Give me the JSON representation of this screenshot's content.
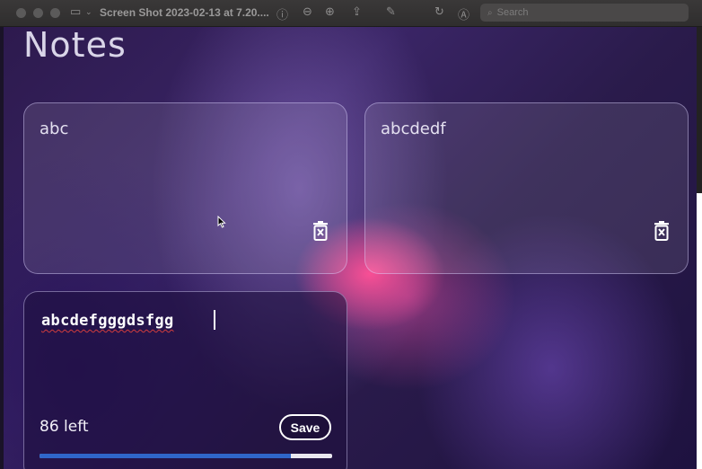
{
  "window": {
    "title": "Screen Shot 2023-02-13 at 7.20....",
    "search_placeholder": "Search"
  },
  "app": {
    "title": "Notes",
    "notes": [
      {
        "text": "abc"
      },
      {
        "text": "abcdedf"
      }
    ],
    "editor": {
      "value": "abcdefgggdsfgg",
      "chars_left_label": "86 left",
      "save_label": "Save",
      "progress_fraction": 0.86
    }
  },
  "colors": {
    "progress_fill": "#2f66c9",
    "progress_track": "#e9e7ef",
    "spellcheck_underline": "#d23c3c"
  },
  "icons": [
    "sidebar-toggle-icon",
    "chevron-down-icon",
    "info-icon",
    "zoom-out-icon",
    "zoom-in-icon",
    "share-icon",
    "markup-icon",
    "rotate-icon",
    "annotate-icon",
    "search-icon",
    "trash-icon",
    "mouse-pointer-icon"
  ]
}
